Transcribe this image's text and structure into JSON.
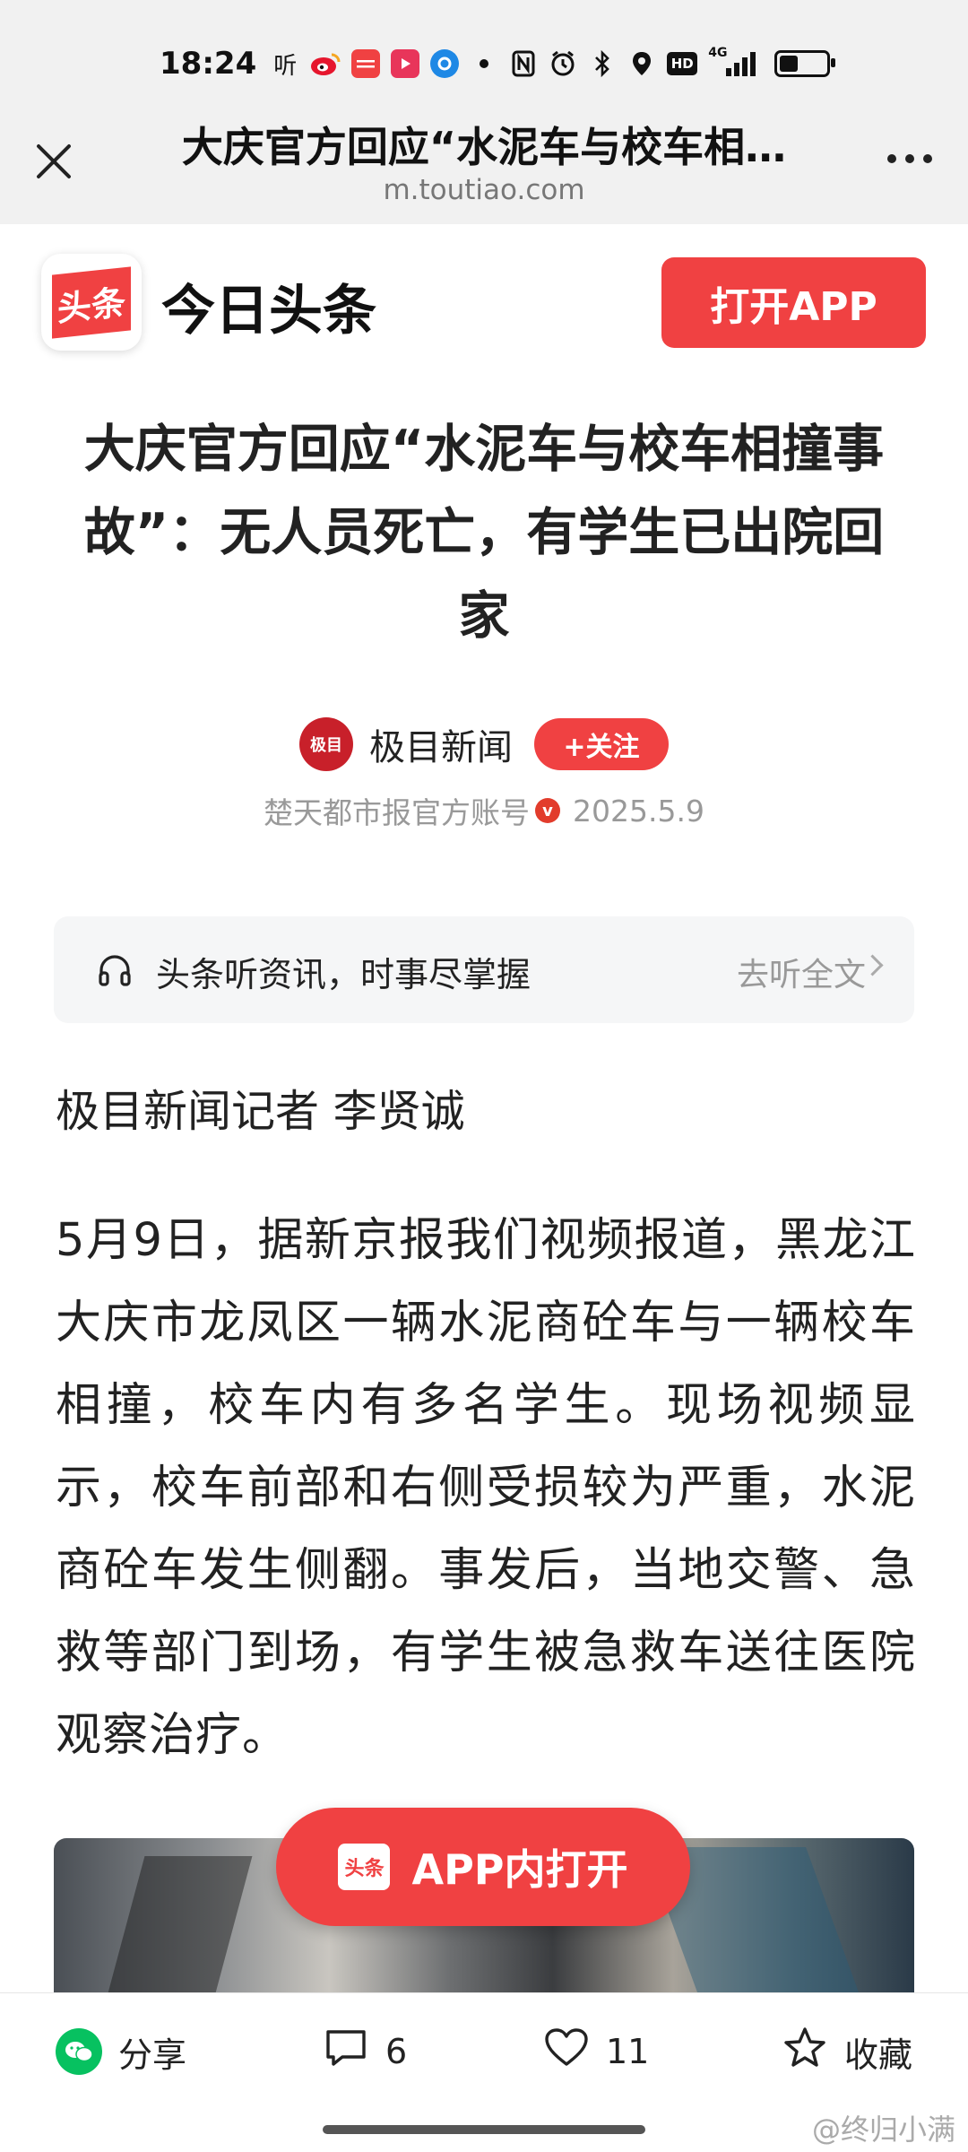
{
  "status_bar": {
    "time": "18:24",
    "icons": [
      "listen-icon",
      "weibo-icon",
      "toutiao-icon",
      "video-app-icon",
      "browser-app-icon",
      "dot-icon",
      "nfc-icon",
      "alarm-icon",
      "bluetooth-icon",
      "location-icon",
      "hd-icon",
      "signal-4g-icon",
      "battery-icon"
    ],
    "listen_glyph": "听",
    "hd_label": "HD",
    "signal_label": "4G",
    "battery_level": 0.45
  },
  "browser": {
    "title": "大庆官方回应“水泥车与校车相…",
    "url": "m.toutiao.com"
  },
  "site": {
    "logo_text": "头条",
    "brand": "今日头条",
    "open_app_label": "打开APP"
  },
  "article": {
    "title": "大庆官方回应“水泥车与校车相撞事故”：无人员死亡，有学生已出院回家",
    "author": {
      "avatar_text": "极目",
      "name": "极目新闻",
      "follow_label": "+关注"
    },
    "meta": {
      "account": "楚天都市报官方账号",
      "verified_mark": "v",
      "date": "2025.5.9"
    },
    "listen": {
      "text": "头条听资讯，时事尽掌握",
      "action": "去听全文"
    },
    "byline": "极目新闻记者 李贤诚",
    "paragraph": "5月9日，据新京报我们视频报道，黑龙江大庆市龙凤区一辆水泥商砼车与一辆校车相撞，校车内有多名学生。现场视频显示，校车前部和右侧受损较为严重，水泥商砼车发生侧翻。事发后，当地交警、急救等部门到场，有学生被急救车送往医院观察治疗。"
  },
  "float_button": {
    "icon_text": "头条",
    "label": "APP内打开"
  },
  "actions": {
    "share": "分享",
    "comments": "6",
    "likes": "11",
    "favorite": "收藏"
  },
  "watermark": "@终归小满",
  "colors": {
    "accent": "#f04142",
    "wechat": "#07c160"
  }
}
